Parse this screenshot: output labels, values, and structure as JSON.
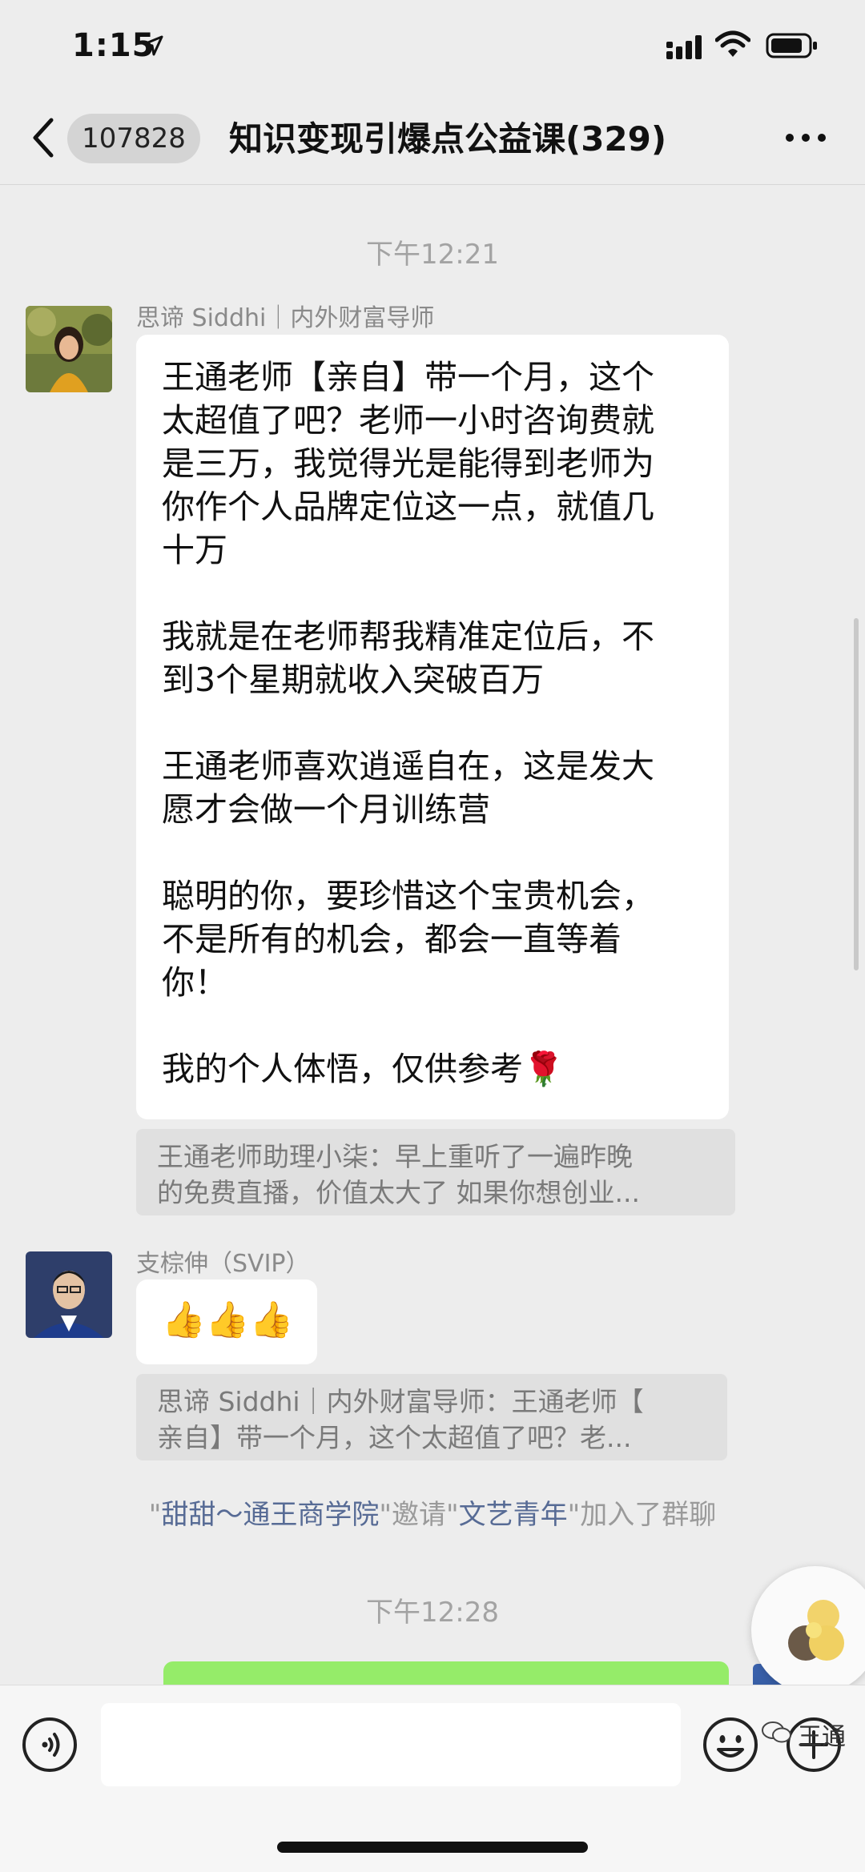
{
  "status": {
    "time": "1:15"
  },
  "header": {
    "unread_count": "107828",
    "title": "知识变现引爆点公益课(329)"
  },
  "messages": {
    "t1": "下午12:21",
    "m1": {
      "sender": "思谛 Siddhi｜内外财富导师",
      "text": "王通老师【亲自】带一个月，这个\n太超值了吧？老师一小时咨询费就\n是三万，我觉得光是能得到老师为\n你作个人品牌定位这一点，就值几\n十万\n\n我就是在老师帮我精准定位后，不\n到3个星期就收入突破百万\n\n王通老师喜欢逍遥自在，这是发大\n愿才会做一个月训练营\n\n聪明的你，要珍惜这个宝贵机会，\n不是所有的机会，都会一直等着\n你！\n\n我的个人体悟，仅供参考🌹",
      "quote_line1": "王通老师助理小柒：早上重听了一遍昨晚",
      "quote_line2": "的免费直播，价值太大了  如果你想创业..."
    },
    "m2": {
      "sender": "支棕伸（SVIP）",
      "text": "👍👍👍",
      "quote_line1": "思谛 Siddhi｜内外财富导师：王通老师【",
      "quote_line2": "亲自】带一个月，这个太超值了吧？老..."
    },
    "system": {
      "q1": "\"",
      "name1": "甜甜～通王商学院",
      "mid": "\"邀请\"",
      "name2": "文艺青年",
      "tail": "\"加入了群聊"
    },
    "t2": "下午12:28"
  },
  "watermark": "王通",
  "colors": {
    "background": "#ededed",
    "bubble": "#ffffff",
    "self_bubble": "#95ec69",
    "link": "#576b95"
  }
}
